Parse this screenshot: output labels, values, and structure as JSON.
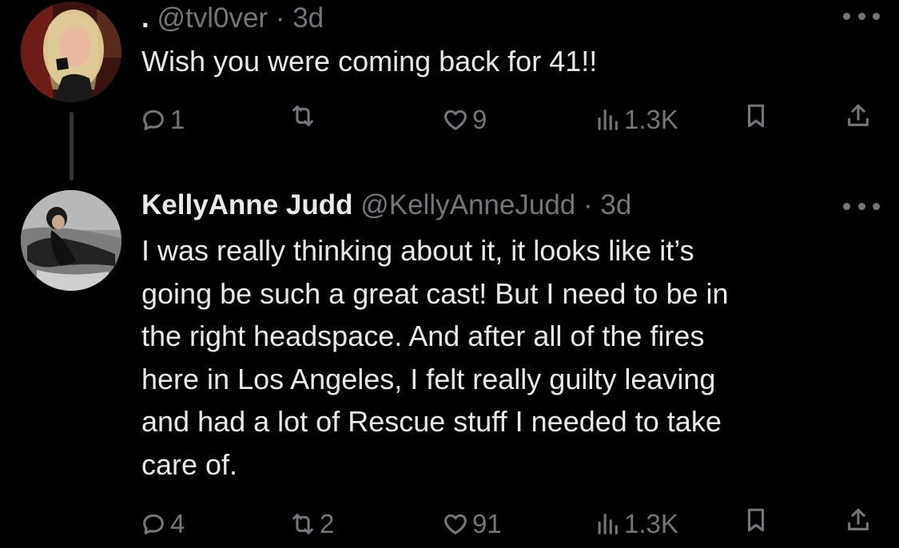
{
  "tweets": [
    {
      "avatar_icon": "user-avatar-blonde-woman",
      "display_name": ".",
      "handle": "@tvl0ver",
      "separator": "·",
      "time": "3d",
      "text": "Wish you were coming back for 41!!",
      "actions": {
        "replies": "1",
        "retweets": "",
        "likes": "9",
        "views": "1.3K"
      }
    },
    {
      "avatar_icon": "user-avatar-woman-reclining",
      "display_name": "KellyAnne Judd",
      "handle": "@KellyAnneJudd",
      "separator": "·",
      "time": "3d",
      "text_lines": [
        "I was really thinking about it, it looks like it’s",
        "going be such a great cast! But I need to be in",
        "the right headspace. And after all of the fires",
        "here in Los Angeles, I felt really guilty leaving",
        "and had a lot of Rescue stuff I needed to take",
        "care of."
      ],
      "actions": {
        "replies": "4",
        "retweets": "2",
        "likes": "91",
        "views": "1.3K"
      }
    }
  ],
  "colors": {
    "background": "#000000",
    "text": "#e7e9ea",
    "muted": "#71767b"
  }
}
